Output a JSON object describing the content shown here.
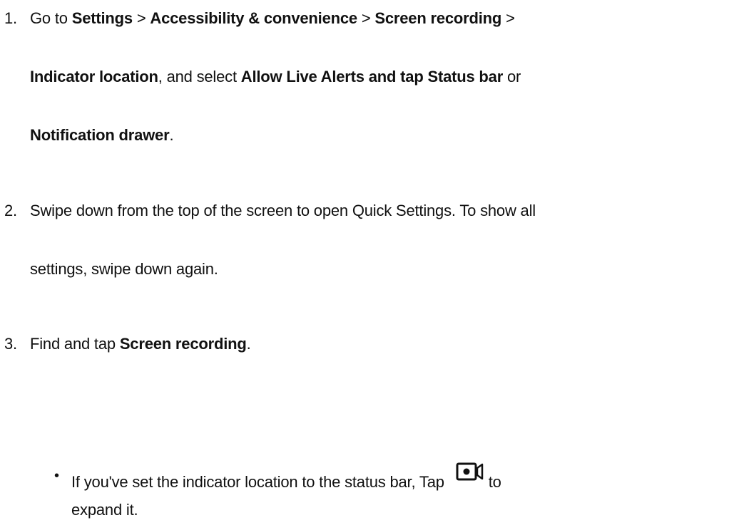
{
  "steps": [
    {
      "number": "1.",
      "line1": {
        "t1": "Go to ",
        "b1": "Settings",
        "t2": " > ",
        "b2": "Accessibility & convenience",
        "t3": " > ",
        "b3": "Screen recording",
        "t4": " >"
      },
      "line2": {
        "b1": "Indicator location",
        "t1": ", and select ",
        "b2": "Allow Live Alerts and tap Status bar",
        "t2": " or"
      },
      "line3": {
        "b1": "Notification drawer",
        "t1": "."
      }
    },
    {
      "number": "2.",
      "line1": "Swipe down from the top of the screen to open Quick Settings. To show all",
      "line2": "settings, swipe down again."
    },
    {
      "number": "3.",
      "line1": {
        "t1": "Find and tap ",
        "b1": "Screen recording",
        "t2": "."
      }
    }
  ],
  "bullet": {
    "marker": "•",
    "line1": {
      "t1": "If you've set the indicator location to the status bar, Tap ",
      "t2": "to"
    },
    "line2": "expand it.",
    "icon": "screen-record-camera-icon"
  },
  "colors": {
    "text": "#111111",
    "background": "#ffffff"
  }
}
